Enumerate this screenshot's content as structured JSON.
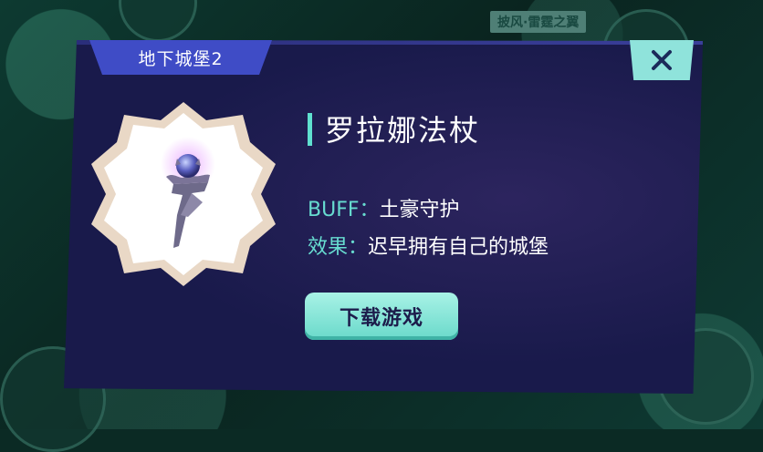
{
  "background": {
    "corner_tag": "披风·雷霆之翼"
  },
  "dialog": {
    "title": "地下城堡2",
    "close_icon": "close-icon",
    "item": {
      "name": "罗拉娜法杖",
      "icon": "staff-icon",
      "buff_label": "BUFF：",
      "buff_value": "土豪守护",
      "effect_label": "效果：",
      "effect_value": "迟早拥有自己的城堡"
    },
    "download_label": "下载游戏"
  },
  "colors": {
    "panel": "#191a4b",
    "tab": "#3f4cc6",
    "accent": "#67dcd0",
    "button": "#8fe3db"
  }
}
